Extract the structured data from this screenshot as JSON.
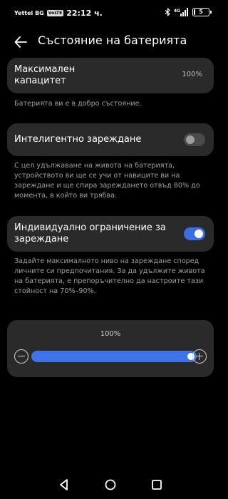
{
  "status_bar": {
    "carrier": "Yettel BG",
    "volte_badge": "VoLTE",
    "time": "22:12 ч.",
    "battery_level": "5",
    "battery_fraction": 0.05,
    "icons": [
      "bluetooth-icon",
      "signal-4g-icon",
      "battery-icon"
    ]
  },
  "header": {
    "back_icon": "arrow-left-icon",
    "title": "Състояние на батерията"
  },
  "capacity": {
    "label": "Максимален капацитет",
    "value": "100%",
    "hint": "Батерията ви е в добро състояние."
  },
  "smart_charging": {
    "label": "Интелигентно зареждане",
    "enabled": false,
    "hint": "С цел удължаване на живота на батерията, устройството ви ще се учи от навиците ви на зареждане и ще спира зареждането отвъд 80% до момента, в който ви трябва."
  },
  "custom_limit": {
    "label": "Индивидуално ограничение за зареждане",
    "enabled": true,
    "hint": "Задайте максималното ниво на зареждане според личните си предпочитания. За да удължите живота на батерията, е препоръчително да настроите тази стойност на 70%–90%."
  },
  "limit_slider": {
    "value_label": "100%",
    "value": 100,
    "min": 0,
    "max": 100,
    "decrease_icon": "minus-circle-icon",
    "increase_icon": "plus-circle-icon"
  },
  "nav_bar": {
    "icons": [
      "back-triangle-icon",
      "home-circle-icon",
      "recents-square-icon"
    ]
  },
  "colors": {
    "background": "#000000",
    "card": "#2a2a2a",
    "accent": "#3f73ea",
    "hint_text": "#a0a0a0"
  }
}
